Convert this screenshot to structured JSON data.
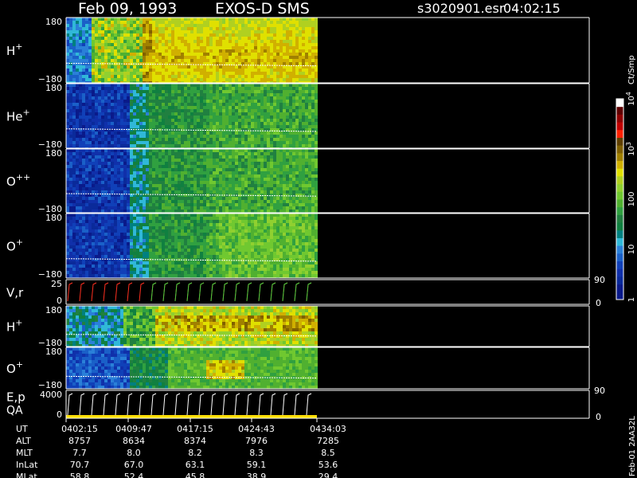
{
  "header": {
    "date": "Feb 09, 1993",
    "instrument": "EXOS-D SMS",
    "file": "s3020901.esr",
    "time": "04:02:15"
  },
  "chart_data": {
    "type": "heatmap",
    "panels": [
      {
        "label": "H",
        "sup": "+",
        "ticks": [
          "180",
          "−180"
        ],
        "profile": "h"
      },
      {
        "label": "He",
        "sup": "+",
        "ticks": [
          "180",
          "−180"
        ],
        "profile": "he"
      },
      {
        "label": "O",
        "sup": "++",
        "ticks": [
          "180",
          "−180"
        ],
        "profile": "opp"
      },
      {
        "label": "O",
        "sup": "+",
        "ticks": [
          "180",
          "−180"
        ],
        "profile": "op"
      },
      {
        "label": "V,r",
        "sup": "",
        "ticks": [
          "25",
          "0"
        ],
        "right_ticks": [
          "90",
          "0"
        ],
        "profile": "line"
      },
      {
        "label": "H",
        "sup": "+",
        "ticks": [
          "180",
          "−180"
        ],
        "profile": "h2"
      },
      {
        "label": "O",
        "sup": "+",
        "ticks": [
          "180",
          "−180"
        ],
        "profile": "o2"
      },
      {
        "label": "E,p",
        "label2": "QA",
        "sup": "",
        "ticks": [
          "4000",
          "0"
        ],
        "right_ticks": [
          "90",
          "0"
        ],
        "profile": "line2"
      }
    ],
    "colorbar": {
      "unit": "Ct/Smp",
      "labels": [
        {
          "text": "10",
          "exp": "4",
          "value": 4
        },
        {
          "text": "10",
          "exp": "3",
          "value": 3
        },
        {
          "text": "100",
          "exp": "",
          "value": 2
        },
        {
          "text": "10",
          "exp": "",
          "value": 1
        },
        {
          "text": "1",
          "exp": "",
          "value": 0
        }
      ],
      "colors": [
        "#0a1a8a",
        "#0a1a8a",
        "#0a2a9a",
        "#1030aa",
        "#1040b8",
        "#1a60c8",
        "#2a80d8",
        "#30b8d8",
        "#008080",
        "#108040",
        "#208040",
        "#30a040",
        "#50b030",
        "#70c830",
        "#90d030",
        "#b0d020",
        "#e0e000",
        "#d0b000",
        "#a08000",
        "#806000",
        "#604000",
        "#ff2000",
        "#c00000",
        "#900000",
        "#600000",
        "#ffffff"
      ]
    },
    "time_ticks": [
      "0402:15",
      "0409:47",
      "0417:15",
      "0424:43",
      "0434:03"
    ],
    "orbit_rows": [
      {
        "label": "UT",
        "values": [
          "0402:15",
          "0409:47",
          "0417:15",
          "0424:43",
          "0434:03"
        ]
      },
      {
        "label": "ALT",
        "values": [
          "8757",
          "8634",
          "8374",
          "7976",
          "7285"
        ]
      },
      {
        "label": "MLT",
        "values": [
          "7.7",
          "8.0",
          "8.2",
          "8.3",
          "8.5"
        ]
      },
      {
        "label": "InLat",
        "values": [
          "70.7",
          "67.0",
          "63.1",
          "59.1",
          "53.6"
        ]
      },
      {
        "label": "MLat",
        "values": [
          "58.8",
          "52.4",
          "45.8",
          "38.9",
          "29.4"
        ]
      }
    ],
    "stamp": "Feb-01 2AA32L"
  }
}
